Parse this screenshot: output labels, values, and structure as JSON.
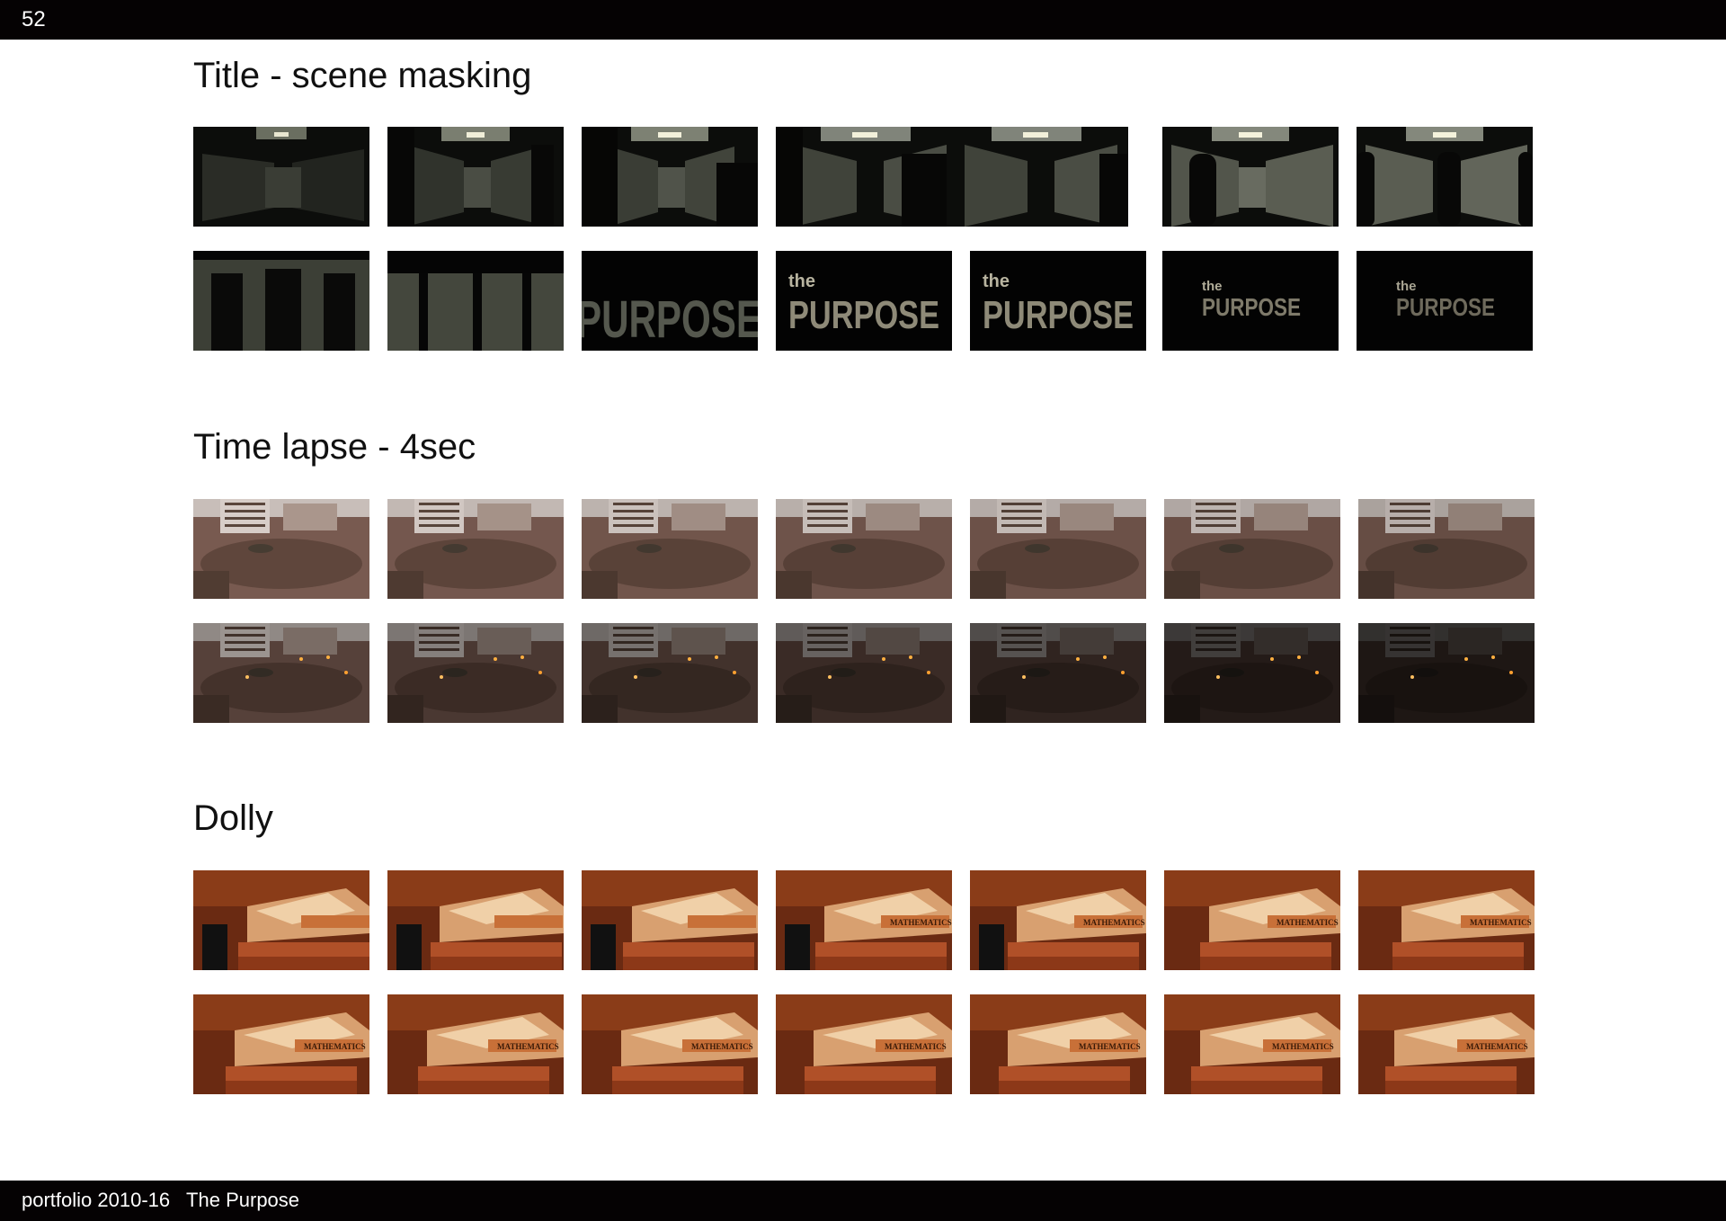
{
  "page": {
    "number": "52"
  },
  "footer": {
    "text": "portfolio 2010-16   The Purpose"
  },
  "sections": [
    {
      "title": "Title - scene masking"
    },
    {
      "title": "Time lapse - 4sec"
    },
    {
      "title": "Dolly"
    }
  ],
  "thumbnails": {
    "title_text": "PURPOSE",
    "title_small": "the",
    "book_label": "MATHEMATICS"
  },
  "colors": {
    "bar": "#050203",
    "background": "#ffffff"
  }
}
